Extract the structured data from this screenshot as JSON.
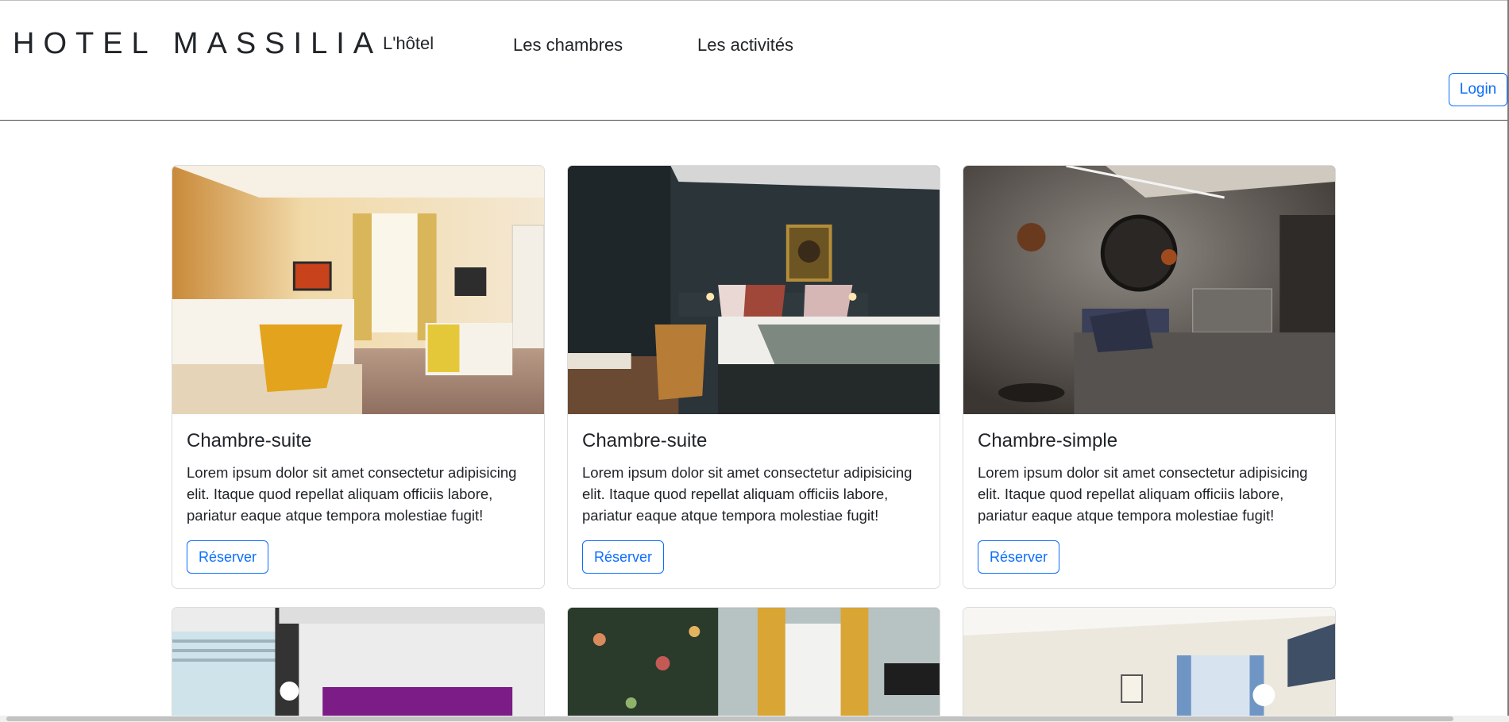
{
  "header": {
    "brand": "HOTEL MASSILIA",
    "nav": [
      {
        "label": "L'hôtel"
      },
      {
        "label": "Les chambres"
      },
      {
        "label": "Les activités"
      }
    ],
    "login_label": "Login"
  },
  "colors": {
    "primary": "#0d6efd",
    "text": "#212529",
    "card_border": "#dcdcdc"
  },
  "rooms": [
    {
      "title": "Chambre-suite",
      "text": "Lorem ipsum dolor sit amet consectetur adipisicing elit. Itaque quod repellat aliquam officiis labore, pariatur eaque atque tempora molestiae fugit!",
      "button": "Réserver"
    },
    {
      "title": "Chambre-suite",
      "text": "Lorem ipsum dolor sit amet consectetur adipisicing elit. Itaque quod repellat aliquam officiis labore, pariatur eaque atque tempora molestiae fugit!",
      "button": "Réserver"
    },
    {
      "title": "Chambre-simple",
      "text": "Lorem ipsum dolor sit amet consectetur adipisicing elit. Itaque quod repellat aliquam officiis labore, pariatur eaque atque tempora molestiae fugit!",
      "button": "Réserver"
    }
  ]
}
